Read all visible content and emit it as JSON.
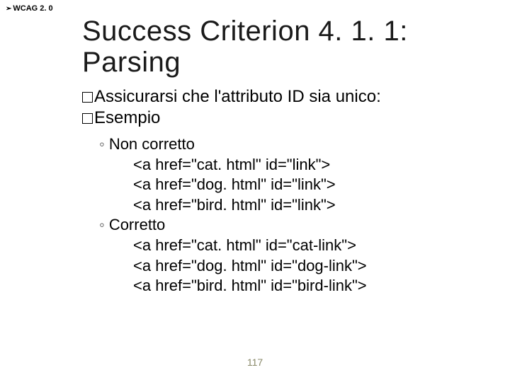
{
  "header": {
    "label": "WCAG 2. 0"
  },
  "title": "Success Criterion 4. 1. 1: Parsing",
  "bullets": {
    "b1": "Assicurarsi che l'attributo ID sia unico:",
    "b2": "Esempio"
  },
  "sub": {
    "wrong_label": "Non corretto",
    "wrong_lines": {
      "l1": "<a href=\"cat. html\" id=\"link\">",
      "l2": "<a href=\"dog. html\" id=\"link\">",
      "l3": "<a href=\"bird. html\" id=\"link\">"
    },
    "right_label": "Corretto",
    "right_lines": {
      "l1": "<a href=\"cat. html\" id=\"cat-link\">",
      "l2": "<a href=\"dog. html\" id=\"dog-link\">",
      "l3": "<a href=\"bird. html\" id=\"bird-link\">"
    }
  },
  "page_number": "117"
}
